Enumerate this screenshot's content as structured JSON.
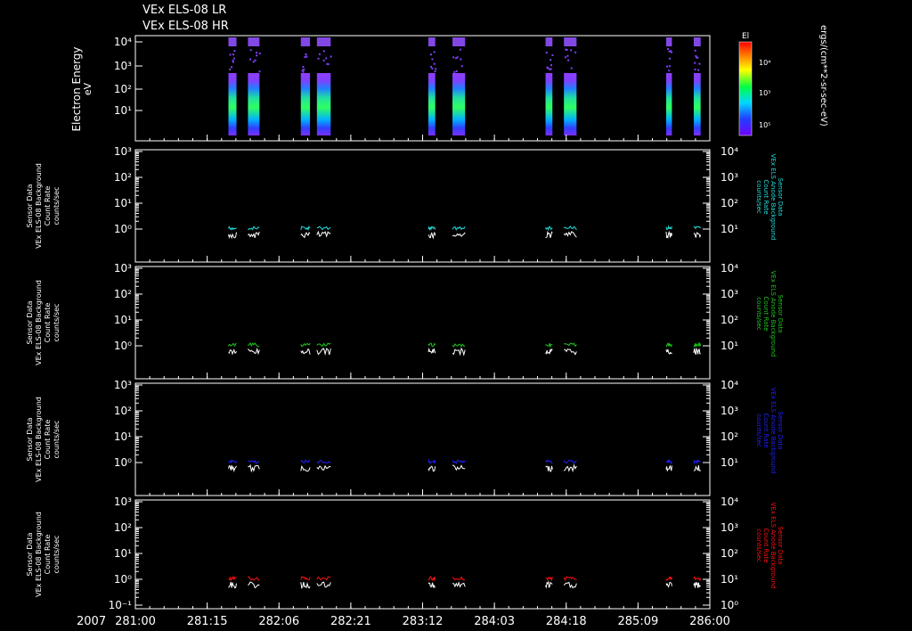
{
  "header": {
    "line1": "VEx ELS-08 LR",
    "line2": "VEx ELS-08 HR"
  },
  "colorbar": {
    "title": "El",
    "tick_labels": [
      "10⁴",
      "10³",
      "10⁵"
    ],
    "unit_label": "ergs/(cm**2-sr-sec-eV)"
  },
  "x_axis": {
    "year": "2007",
    "tick_labels": [
      "281:00",
      "281:15",
      "282:06",
      "282:21",
      "283:12",
      "284:03",
      "284:18",
      "285:09",
      "286:00"
    ]
  },
  "colors": {
    "cyan": "#22e0e0",
    "green": "#1cc81c",
    "blue": "#2020ff",
    "red": "#ff1010",
    "white": "#ffffff"
  },
  "chart_data": [
    {
      "type": "heatmap",
      "ylabel": "Electron Energy",
      "yunit": "eV",
      "ytick_labels": [
        "10⁴",
        "10³",
        "10²",
        "10¹"
      ],
      "data_intervals_doy": [
        [
          281.81,
          281.88
        ],
        [
          281.98,
          282.08
        ],
        [
          282.44,
          282.52
        ],
        [
          282.58,
          282.7
        ],
        [
          283.55,
          283.61
        ],
        [
          283.76,
          283.87
        ],
        [
          284.57,
          284.63
        ],
        [
          284.73,
          284.84
        ],
        [
          285.62,
          285.67
        ],
        [
          285.86,
          285.92
        ]
      ]
    },
    {
      "type": "line",
      "ylabel_lines": [
        "Sensor Data",
        "VEx ELS-08 Background",
        "Count Rate",
        "counts/sec"
      ],
      "right_label_lines": [
        "Sensor Data",
        "VEx ELS Anode Background",
        "Count Rate",
        "counts/sec"
      ],
      "left_ticks": [
        "10³",
        "10²",
        "10¹",
        "10⁰"
      ],
      "right_ticks": [
        "10⁴",
        "10³",
        "10²",
        "10¹"
      ],
      "series_color": "cyan"
    },
    {
      "type": "line",
      "ylabel_lines": [
        "Sensor Data",
        "VEx ELS-08 Background",
        "Count Rate",
        "counts/sec"
      ],
      "right_label_lines": [
        "Sensor Data",
        "VEx ELS Anode Background",
        "Count Rate",
        "counts/sec"
      ],
      "left_ticks": [
        "10³",
        "10²",
        "10¹",
        "10⁰"
      ],
      "right_ticks": [
        "10⁴",
        "10³",
        "10²",
        "10¹"
      ],
      "series_color": "green"
    },
    {
      "type": "line",
      "ylabel_lines": [
        "Sensor Data",
        "VEx ELS-08 Background",
        "Count Rate",
        "counts/sec"
      ],
      "right_label_lines": [
        "Sensor Data",
        "VEx ELS Anode Background",
        "Count Rate",
        "counts/sec"
      ],
      "left_ticks": [
        "10³",
        "10²",
        "10¹",
        "10⁰"
      ],
      "right_ticks": [
        "10⁴",
        "10³",
        "10²",
        "10¹"
      ],
      "series_color": "blue"
    },
    {
      "type": "line",
      "ylabel_lines": [
        "Sensor Data",
        "VEx ELS-08 Background",
        "Count Rate",
        "counts/sec"
      ],
      "right_label_lines": [
        "Sensor Data",
        "VEx ELS Anode Background",
        "Count Rate",
        "counts/sec"
      ],
      "left_ticks": [
        "10³",
        "10²",
        "10¹",
        "10⁰",
        "10⁻¹"
      ],
      "right_ticks": [
        "10⁴",
        "10³",
        "10²",
        "10¹",
        "10⁰"
      ],
      "series_color": "red"
    }
  ]
}
